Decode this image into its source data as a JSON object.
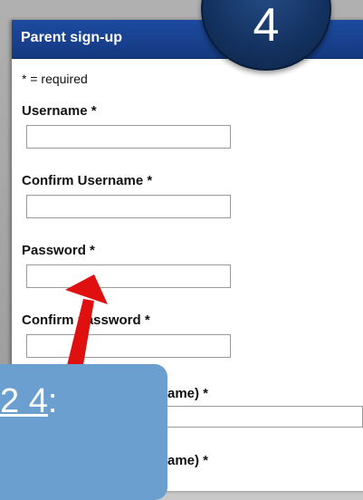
{
  "window": {
    "title": "Parent sign-up"
  },
  "form": {
    "required_note": "* = required",
    "fields": [
      {
        "label": "Username *",
        "value": ""
      },
      {
        "label": "Confirm Username *",
        "value": ""
      },
      {
        "label": "Password *",
        "value": ""
      },
      {
        "label": "Confirm password *",
        "value": ""
      },
      {
        "label": "ame) *",
        "value": ""
      },
      {
        "label": "ame) *",
        "value": ""
      }
    ]
  },
  "overlay": {
    "step_badge": "4",
    "callout_prefix": "",
    "callout_underlined": "2 4",
    "callout_suffix": ":"
  },
  "colors": {
    "header_blue": "#14397f",
    "badge_blue": "#13315f",
    "callout_blue": "#6b9fd0",
    "arrow_red": "#e01010"
  }
}
